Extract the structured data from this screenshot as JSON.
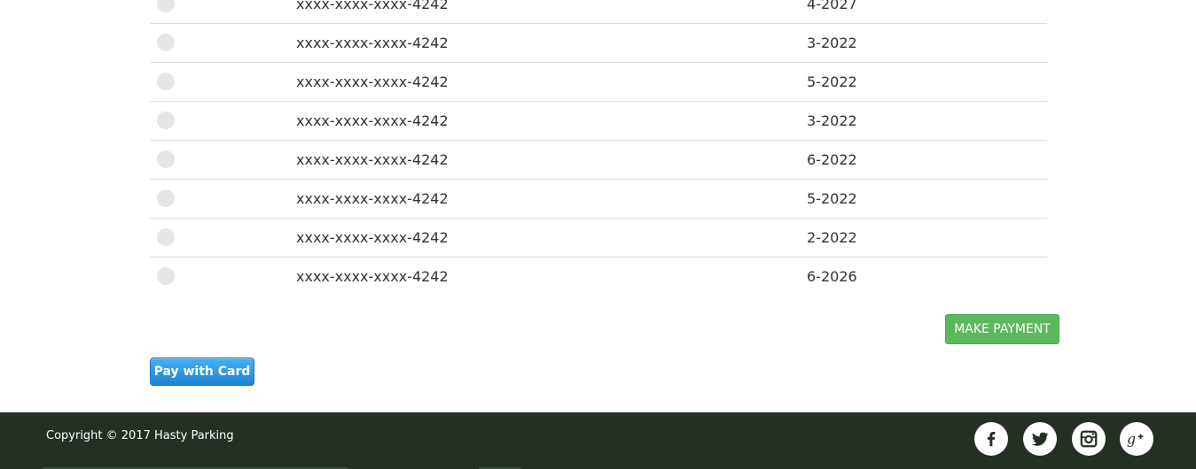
{
  "cards": [
    {
      "number": "xxxx-xxxx-xxxx-4242",
      "expiry": "4-2027"
    },
    {
      "number": "xxxx-xxxx-xxxx-4242",
      "expiry": "3-2022"
    },
    {
      "number": "xxxx-xxxx-xxxx-4242",
      "expiry": "5-2022"
    },
    {
      "number": "xxxx-xxxx-xxxx-4242",
      "expiry": "3-2022"
    },
    {
      "number": "xxxx-xxxx-xxxx-4242",
      "expiry": "6-2022"
    },
    {
      "number": "xxxx-xxxx-xxxx-4242",
      "expiry": "5-2022"
    },
    {
      "number": "xxxx-xxxx-xxxx-4242",
      "expiry": "2-2022"
    },
    {
      "number": "xxxx-xxxx-xxxx-4242",
      "expiry": "6-2026"
    }
  ],
  "actions": {
    "make_payment_label": "MAKE PAYMENT",
    "pay_with_card_label": "Pay with Card"
  },
  "footer": {
    "copyright": "Copyright © 2017 Hasty Parking",
    "social_icons": [
      "facebook-icon",
      "twitter-icon",
      "instagram-icon",
      "google-plus-icon"
    ]
  },
  "colors": {
    "make_payment_bg": "#5cb85c",
    "pay_card_bg": "#1b83d6",
    "footer_bg": "#243024"
  }
}
